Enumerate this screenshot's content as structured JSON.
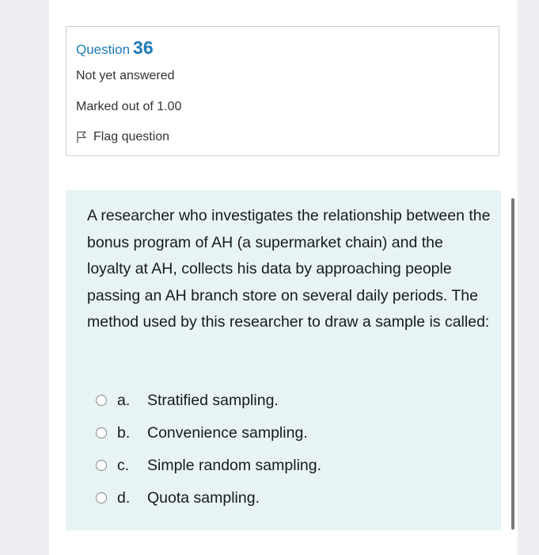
{
  "info": {
    "question_label": "Question",
    "question_number": "36",
    "status": "Not yet answered",
    "marks": "Marked out of 1.00",
    "flag_label": "Flag question"
  },
  "question": {
    "text": "A researcher who investigates the relationship between the bonus program of AH (a supermarket chain) and the loyalty at AH, collects his data by approaching people passing an AH branch store on several daily periods. The method used by this researcher to draw a sample is called:",
    "options": [
      {
        "letter": "a.",
        "label": "Stratified sampling."
      },
      {
        "letter": "b.",
        "label": "Convenience sampling."
      },
      {
        "letter": "c.",
        "label": "Simple random sampling."
      },
      {
        "letter": "d.",
        "label": "Quota sampling."
      }
    ]
  },
  "colors": {
    "accent": "#1f7ab8",
    "question_bg": "#e7f3f5"
  }
}
